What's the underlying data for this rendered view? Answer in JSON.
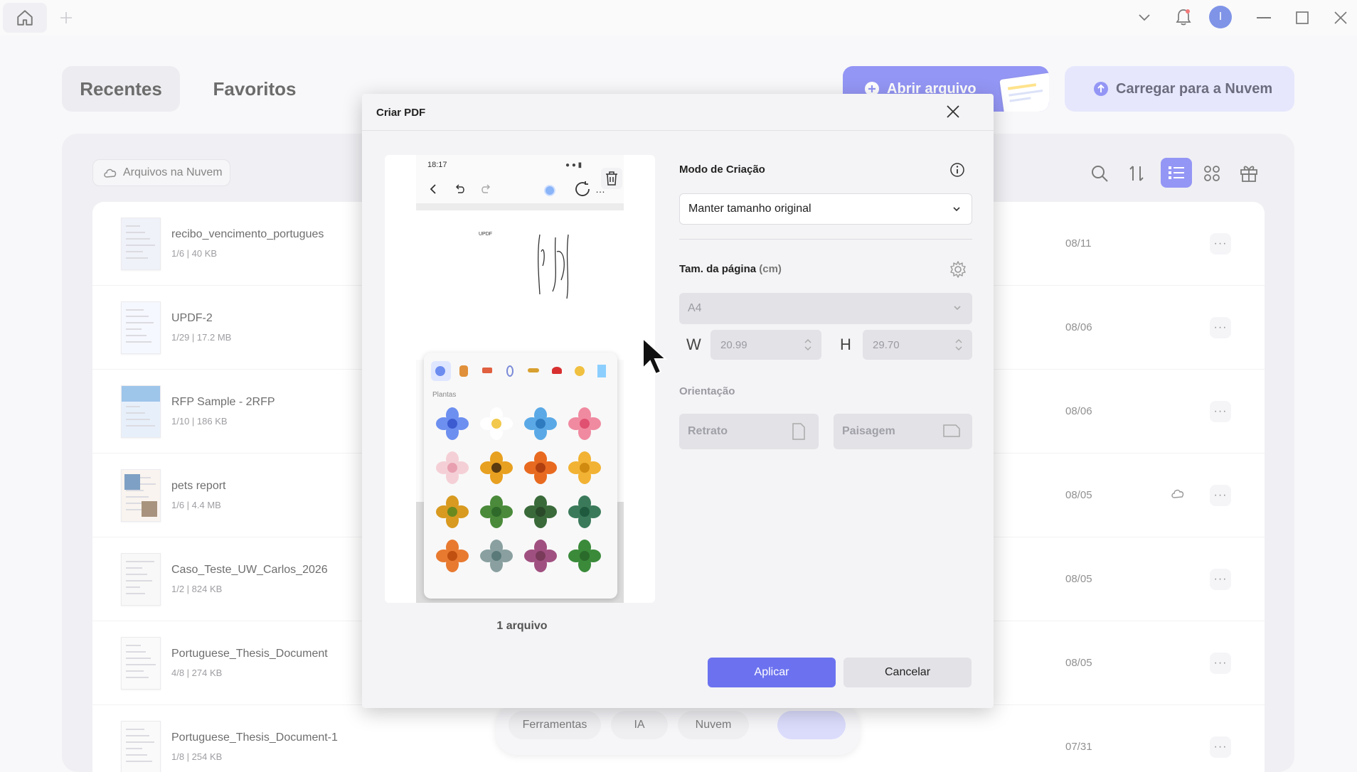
{
  "window": {
    "home_icon": "home-icon",
    "new_tab_icon": "plus-icon",
    "avatar_letter": "I"
  },
  "main": {
    "tabs": [
      {
        "label": "Recentes",
        "active": true
      },
      {
        "label": "Favoritos",
        "active": false
      }
    ],
    "open_file_button": "Abrir arquivo",
    "upload_cloud_button": "Carregar para a Nuvem",
    "cloud_files_chip": "Arquivos na Nuvem",
    "files": [
      {
        "name": "recibo_vencimento_portugues",
        "meta": "1/6 | 40 KB",
        "date": "08/11",
        "cloud": false
      },
      {
        "name": "UPDF-2",
        "meta": "1/29 | 17.2 MB",
        "date": "08/06",
        "cloud": false
      },
      {
        "name": "RFP Sample - 2RFP",
        "meta": "1/10 | 186 KB",
        "date": "08/06",
        "cloud": false
      },
      {
        "name": "pets report",
        "meta": "1/6 | 4.4 MB",
        "date": "08/05",
        "cloud": true
      },
      {
        "name": "Caso_Teste_UW_Carlos_2026",
        "meta": "1/2 | 824 KB",
        "date": "08/05",
        "cloud": false
      },
      {
        "name": "Portuguese_Thesis_Document",
        "meta": "4/8 | 274 KB",
        "date": "08/05",
        "cloud": false
      },
      {
        "name": "Portuguese_Thesis_Document-1",
        "meta": "1/8 | 254 KB",
        "date": "07/31",
        "cloud": false
      }
    ],
    "more_label": "···",
    "bottom_nav": [
      "Ferramentas",
      "IA",
      "Nuvem"
    ]
  },
  "dialog": {
    "title": "Criar PDF",
    "files_count": "1 arquivo",
    "creation_mode_label": "Modo de Criação",
    "creation_mode_value": "Manter tamanho original",
    "page_size_label": "Tam. da página",
    "page_size_unit": "(cm)",
    "page_size_value": "A4",
    "width_label": "W",
    "width_value": "20.99",
    "height_label": "H",
    "height_value": "29.70",
    "orientation_label": "Orientação",
    "portrait_label": "Retrato",
    "landscape_label": "Paisagem",
    "apply_button": "Aplicar",
    "cancel_button": "Cancelar",
    "preview": {
      "status_time": "18:17",
      "doc_label": "UPDF",
      "sticker_category": "Plantas"
    }
  },
  "colors": {
    "accent": "#6c72ef",
    "cta_blue": "#5b5ff0",
    "cta_light": "#d9dbfb"
  }
}
